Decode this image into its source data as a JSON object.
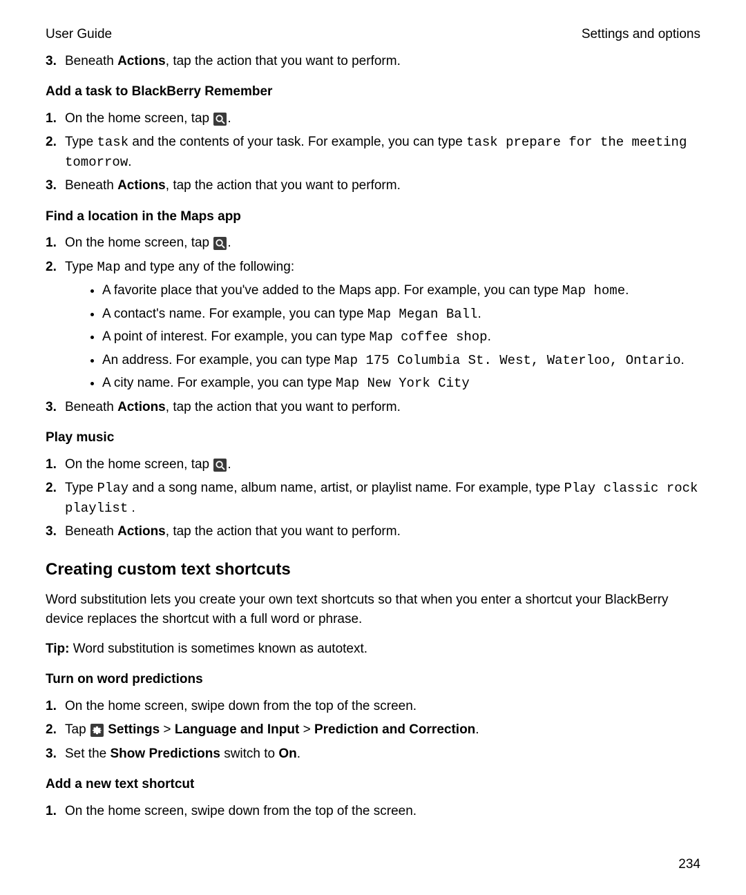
{
  "header": {
    "left": "User Guide",
    "right": "Settings and options"
  },
  "page_number": "234",
  "line3": {
    "n": "3.",
    "pre": "Beneath ",
    "bold": "Actions",
    "post": ", tap the action that you want to perform."
  },
  "sec_task": {
    "title": "Add a task to BlackBerry Remember",
    "i1": {
      "n": "1.",
      "pre": "On the home screen, tap ",
      "post": "."
    },
    "i2": {
      "n": "2.",
      "a": "Type ",
      "m1": "task",
      "b": " and the contents of your task. For example, you can type ",
      "m2": "task prepare for the meeting tomorrow",
      "c": "."
    },
    "i3": {
      "n": "3.",
      "pre": "Beneath ",
      "bold": "Actions",
      "post": ", tap the action that you want to perform."
    }
  },
  "sec_maps": {
    "title": "Find a location in the Maps app",
    "i1": {
      "n": "1.",
      "pre": "On the home screen, tap ",
      "post": "."
    },
    "i2": {
      "n": "2.",
      "a": "Type ",
      "m1": "Map",
      "b": " and type any of the following:"
    },
    "b1": {
      "a": "A favorite place that you've added to the Maps app. For example, you can type ",
      "m": "Map home",
      "c": "."
    },
    "b2": {
      "a": "A contact's name. For example, you can type ",
      "m": "Map Megan Ball",
      "c": "."
    },
    "b3": {
      "a": "A point of interest. For example, you can type ",
      "m": "Map coffee shop",
      "c": "."
    },
    "b4": {
      "a": "An address. For example, you can type ",
      "m": "Map 175 Columbia St. West, Waterloo, Ontario",
      "c": "."
    },
    "b5": {
      "a": "A city name. For example, you can type ",
      "m": "Map New York City"
    },
    "i3": {
      "n": "3.",
      "pre": "Beneath ",
      "bold": "Actions",
      "post": ", tap the action that you want to perform."
    }
  },
  "sec_music": {
    "title": "Play music",
    "i1": {
      "n": "1.",
      "pre": "On the home screen, tap ",
      "post": "."
    },
    "i2": {
      "n": "2.",
      "a": "Type ",
      "m1": "Play",
      "b": " and a song name, album name, artist, or playlist name. For example, type ",
      "m2": "Play classic rock playlist",
      "c": " ."
    },
    "i3": {
      "n": "3.",
      "pre": "Beneath ",
      "bold": "Actions",
      "post": ", tap the action that you want to perform."
    }
  },
  "sec_shortcuts": {
    "title": "Creating custom text shortcuts",
    "para": "Word substitution lets you create your own text shortcuts so that when you enter a shortcut your BlackBerry device replaces the shortcut with a full word or phrase.",
    "tip_b": "Tip:",
    "tip_t": " Word substitution is sometimes known as autotext."
  },
  "sec_pred": {
    "title": "Turn on word predictions",
    "i1": {
      "n": "1.",
      "t": "On the home screen, swipe down from the top of the screen."
    },
    "i2": {
      "n": "2.",
      "a": "Tap ",
      "b1": " Settings",
      "g1": " > ",
      "b2": "Language and Input",
      "g2": " > ",
      "b3": "Prediction and Correction",
      "c": "."
    },
    "i3": {
      "n": "3.",
      "a": "Set the ",
      "b1": "Show Predictions",
      "b": " switch to ",
      "b2": "On",
      "c": "."
    }
  },
  "sec_newshort": {
    "title": "Add a new text shortcut",
    "i1": {
      "n": "1.",
      "t": "On the home screen, swipe down from the top of the screen."
    }
  }
}
